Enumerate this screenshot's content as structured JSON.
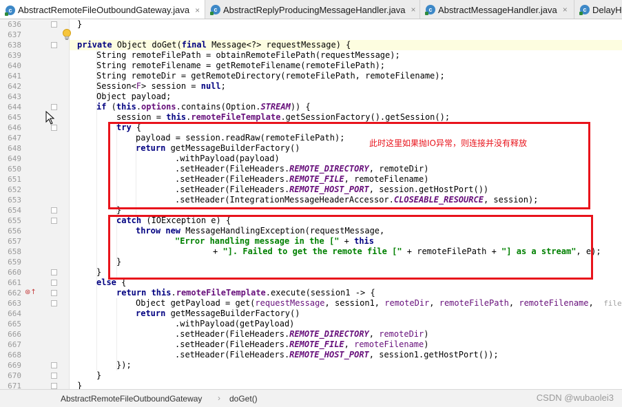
{
  "tabs": [
    {
      "label": "AbstractRemoteFileOutboundGateway.java",
      "icon": "c",
      "active": true,
      "closable": true
    },
    {
      "label": "AbstractReplyProducingMessageHandler.java",
      "icon": "c",
      "closable": true
    },
    {
      "label": "AbstractMessageHandler.java",
      "icon": "c",
      "closable": true
    },
    {
      "label": "DelayHa",
      "icon": "c",
      "closable": false
    }
  ],
  "close_glyph": "×",
  "line_numbers": [
    "636",
    "637",
    "638",
    "639",
    "640",
    "641",
    "642",
    "643",
    "644",
    "645",
    "646",
    "647",
    "648",
    "649",
    "650",
    "651",
    "652",
    "653",
    "654",
    "655",
    "656",
    "657",
    "658",
    "659",
    "660",
    "661",
    "662",
    "663",
    "664",
    "665",
    "666",
    "667",
    "668",
    "669",
    "670",
    "671"
  ],
  "annotation": {
    "note": "此时这里如果抛IO异常，则连接并没有释放"
  },
  "breadcrumb": {
    "class_name": "AbstractRemoteFileOutboundGateway",
    "separator": "›",
    "method_name": "doGet()"
  },
  "watermark": "CSDN @wubaolei3",
  "gutter_marker": "⊛↑",
  "colors": {
    "annotation_red": "#e8131b",
    "keyword": "#000080",
    "string": "#008000",
    "field": "#660e7a"
  }
}
